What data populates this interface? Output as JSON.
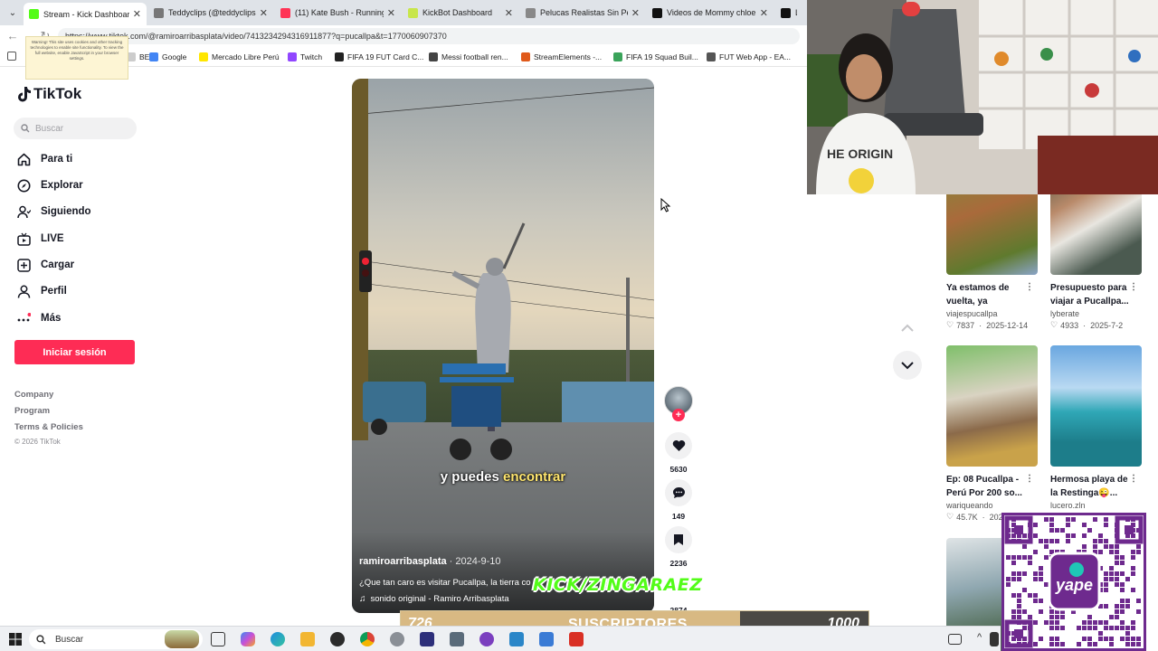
{
  "browser": {
    "tabs": [
      {
        "title": "Stream - Kick Dashboard",
        "color": "#53fc18",
        "active": true
      },
      {
        "title": "Teddyclips (@teddyclips2) |",
        "color": "#777777",
        "active": false
      },
      {
        "title": "(11) Kate Bush - Running Up",
        "color": "#ff3355",
        "active": false
      },
      {
        "title": "KickBot Dashboard",
        "color": "#c8e64b",
        "active": false
      },
      {
        "title": "Pelucas Realistas Sin Pegam",
        "color": "#888888",
        "active": false
      },
      {
        "title": "Videos de Mommy chloe (@",
        "color": "#111111",
        "active": false
      },
      {
        "title": "Lo",
        "color": "#111111",
        "active": false
      }
    ],
    "url": "https://www.tiktok.com/@ramiroarribasplata/video/7413234294316911877?q=pucallpa&t=1770060907370",
    "bookmarks": [
      {
        "label": "BE",
        "color": "#cccccc"
      },
      {
        "label": "Google",
        "color": "#4285f4"
      },
      {
        "label": "Mercado Libre Perú",
        "color": "#ffe600"
      },
      {
        "label": "Twitch",
        "color": "#9146ff"
      },
      {
        "label": "FIFA 19 FUT Card C...",
        "color": "#222222"
      },
      {
        "label": "Messi football ren...",
        "color": "#444444"
      },
      {
        "label": "StreamElements -...",
        "color": "#e05a1b"
      },
      {
        "label": "FIFA 19 Squad Buil...",
        "color": "#3aa35a"
      },
      {
        "label": "FUT Web App - EA...",
        "color": "#555555"
      }
    ],
    "warning_text": "Warning! This site uses cookies and other tracking technologies to enable site functionality. To view the full website, enable JavaScript in your browser settings."
  },
  "tiktok": {
    "logo": "TikTok",
    "search_placeholder": "Buscar",
    "nav": [
      {
        "label": "Para ti",
        "icon": "home-icon"
      },
      {
        "label": "Explorar",
        "icon": "compass-icon"
      },
      {
        "label": "Siguiendo",
        "icon": "following-icon"
      },
      {
        "label": "LIVE",
        "icon": "live-icon"
      },
      {
        "label": "Cargar",
        "icon": "upload-icon"
      },
      {
        "label": "Perfil",
        "icon": "profile-icon"
      },
      {
        "label": "Más",
        "icon": "more-icon"
      }
    ],
    "login_button": "Iniciar sesión",
    "footer_links": [
      "Company",
      "Program",
      "Terms & Policies"
    ],
    "copyright": "© 2026 TikTok",
    "video": {
      "caption_pre": "y puedes ",
      "caption_highlight": "encontrar",
      "author": "ramiroarribasplata",
      "date": "· 2024-9-10",
      "description": "¿Que tan caro es visitar Pucallpa, la tierra co",
      "sound": "sonido original - Ramiro Arribasplata"
    },
    "actions": {
      "likes": "5630",
      "comments": "149",
      "saves": "2236",
      "shares": "2874"
    },
    "related": [
      {
        "title": "Ya estamos de vuelta, ya vuelta!...",
        "author": "viajespucallpa",
        "likes": "7837",
        "date": "2025-12-14"
      },
      {
        "title": "Presupuesto para viajar a Pucallpa...",
        "author": "lyberate",
        "likes": "4933",
        "date": "2025-7-2"
      },
      {
        "title": "Ep: 08 Pucallpa - Perú Por 200 so...",
        "author": "wariqueando",
        "likes": "45.7K",
        "date": "2025-11-28"
      },
      {
        "title": "Hermosa playa de la Restinga😜...",
        "author": "lucero.zln",
        "likes": "",
        "date": ""
      }
    ]
  },
  "overlays": {
    "kick_text": "KICK/ZINGARAEZ",
    "subs_current": "726",
    "subs_label": "SUSCRIPTORES",
    "subs_goal": "1000",
    "subs_progress": 0.726,
    "qr_brand": "yape"
  },
  "taskbar": {
    "search_placeholder": "Buscar"
  }
}
